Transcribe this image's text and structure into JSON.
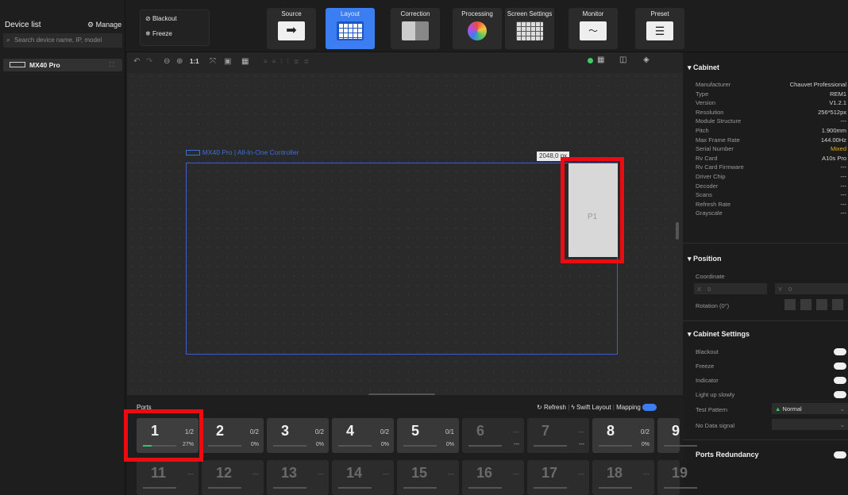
{
  "left": {
    "title": "Device list",
    "manage": "Manage",
    "search_placeholder": "Search device name, IP, model",
    "device": "MX40 Pro"
  },
  "top": {
    "blackout": "Blackout",
    "freeze": "Freeze",
    "tabs": [
      {
        "label": "Source"
      },
      {
        "label": "Layout"
      },
      {
        "label": "Correction"
      },
      {
        "label": "Processing"
      },
      {
        "label": "Screen Settings"
      },
      {
        "label": "Monitor"
      },
      {
        "label": "Preset"
      }
    ],
    "active_tab": "Layout"
  },
  "toolbar": {
    "zoom_reset": "1:1"
  },
  "canvas": {
    "controller_label": "MX40 Pro | All-In-One Controller",
    "width_readout": "2048,0 px",
    "cabinet_label": "P1"
  },
  "cabinet": {
    "title": "Cabinet",
    "rows": [
      {
        "k": "Manufacturer",
        "v": "Chauvet Professional"
      },
      {
        "k": "Type",
        "v": "REM1"
      },
      {
        "k": "Version",
        "v": "V1.2.1"
      },
      {
        "k": "Resolution",
        "v": "256*512px"
      },
      {
        "k": "Module Structure",
        "v": "---"
      },
      {
        "k": "Pitch",
        "v": "1.900mm"
      },
      {
        "k": "Max Frame Rate",
        "v": "144.00Hz"
      },
      {
        "k": "Serial Number",
        "v": "Mixed"
      },
      {
        "k": "Rv Card",
        "v": "A10s Pro"
      },
      {
        "k": "Rv Card Firmware",
        "v": "---"
      },
      {
        "k": "Driver Chip",
        "v": "---"
      },
      {
        "k": "Decoder",
        "v": "---"
      },
      {
        "k": "Scans",
        "v": "---"
      },
      {
        "k": "Refresh Rate",
        "v": "---"
      },
      {
        "k": "Grayscale",
        "v": "---"
      }
    ]
  },
  "position": {
    "title": "Position",
    "coordinate": "Coordinate",
    "x_label": "X",
    "x_value": "0",
    "y_label": "Y",
    "y_value": "0",
    "rotation": "Rotation (0°)"
  },
  "cabinet_settings": {
    "title": "Cabinet Settings",
    "blackout": "Blackout",
    "freeze": "Freeze",
    "indicator": "Indicator",
    "light_up": "Light up slowly",
    "test_pattern": "Test Pattern",
    "test_pattern_value": "Normal",
    "no_data": "No Data signal"
  },
  "ports_redundancy": "Ports Redundancy",
  "ports": {
    "title": "Ports",
    "refresh": "Refresh",
    "swift": "Swift Layout",
    "mapping": "Mapping",
    "row1": [
      {
        "n": "1",
        "frac": "1/2",
        "pct": "27%",
        "fill": 0.27
      },
      {
        "n": "2",
        "frac": "0/2",
        "pct": "0%",
        "fill": 0
      },
      {
        "n": "3",
        "frac": "0/2",
        "pct": "0%",
        "fill": 0
      },
      {
        "n": "4",
        "frac": "0/2",
        "pct": "0%",
        "fill": 0
      },
      {
        "n": "5",
        "frac": "0/1",
        "pct": "0%",
        "fill": 0
      },
      {
        "n": "6",
        "frac": "---",
        "pct": "---",
        "fill": 0
      },
      {
        "n": "7",
        "frac": "---",
        "pct": "---",
        "fill": 0
      },
      {
        "n": "8",
        "frac": "0/2",
        "pct": "0%",
        "fill": 0
      },
      {
        "n": "9",
        "frac": "",
        "pct": "",
        "fill": 0
      }
    ],
    "row2": [
      {
        "n": "11",
        "frac": "---"
      },
      {
        "n": "12",
        "frac": "---"
      },
      {
        "n": "13",
        "frac": "---"
      },
      {
        "n": "14",
        "frac": "---"
      },
      {
        "n": "15",
        "frac": "---"
      },
      {
        "n": "16",
        "frac": "---"
      },
      {
        "n": "17",
        "frac": "---"
      },
      {
        "n": "18",
        "frac": "---"
      },
      {
        "n": "19",
        "frac": ""
      }
    ]
  },
  "colors": {
    "accent": "#3b7ef2",
    "highlight": "#ec0b10",
    "mixed": "#e8b018"
  }
}
